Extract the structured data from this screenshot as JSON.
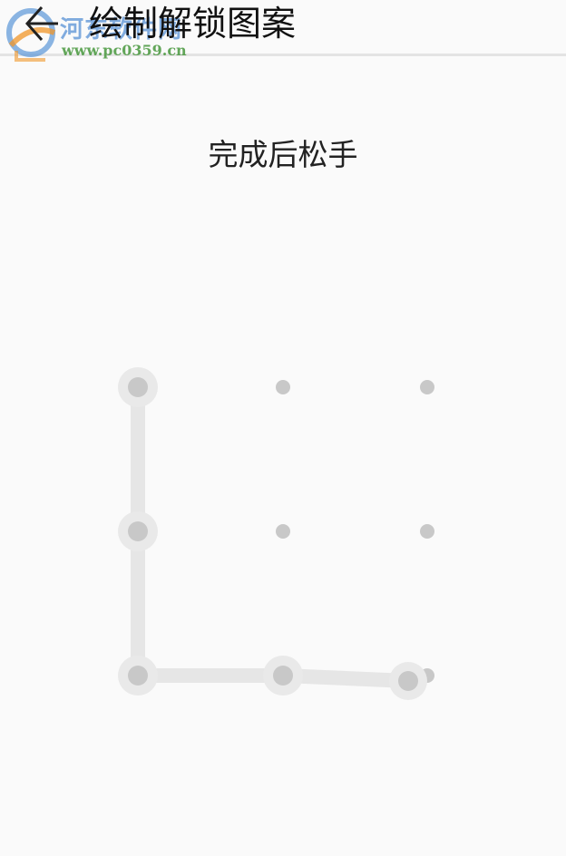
{
  "header": {
    "title": "绘制解锁图案",
    "back_icon": "back-arrow-icon"
  },
  "watermark": {
    "name": "河东软件网",
    "url": "www.pc0359.cn"
  },
  "instruction": "完成后松手",
  "pattern": {
    "grid_size": 3,
    "path": [
      1,
      4,
      7,
      8
    ],
    "drag_ends_at": "right of node 8, toward node 9",
    "colors": {
      "dot": "#c8c8c8",
      "selected_halo": "#e9e9e9",
      "line": "#e6e6e6"
    }
  }
}
